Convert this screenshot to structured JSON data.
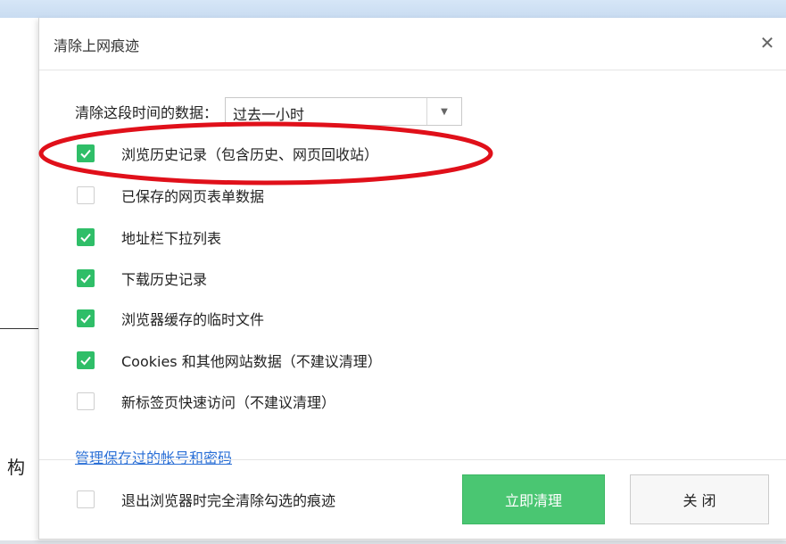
{
  "dialog": {
    "title": "清除上网痕迹",
    "close_symbol": "✕"
  },
  "time_range": {
    "label": "清除这段时间的数据：",
    "selected": "过去一小时"
  },
  "options": [
    {
      "label": "浏览历史记录（包含历史、网页回收站）",
      "checked": true
    },
    {
      "label": "已保存的网页表单数据",
      "checked": false
    },
    {
      "label": "地址栏下拉列表",
      "checked": true
    },
    {
      "label": "下载历史记录",
      "checked": true
    },
    {
      "label": "浏览器缓存的临时文件",
      "checked": true
    },
    {
      "label": "Cookies 和其他网站数据（不建议清理）",
      "checked": true
    },
    {
      "label": "新标签页快速访问（不建议清理）",
      "checked": false
    }
  ],
  "manage_link": "管理保存过的帐号和密码",
  "footer": {
    "exit_clear_label": "退出浏览器时完全清除勾选的痕迹",
    "exit_clear_checked": false,
    "clear_button": "立即清理",
    "close_button": "关 闭"
  },
  "background": {
    "partial_glyph": "构"
  },
  "colors": {
    "accent_green": "#2fbe68",
    "link_blue": "#2a6fd6",
    "annotation_red": "#e0101a"
  }
}
